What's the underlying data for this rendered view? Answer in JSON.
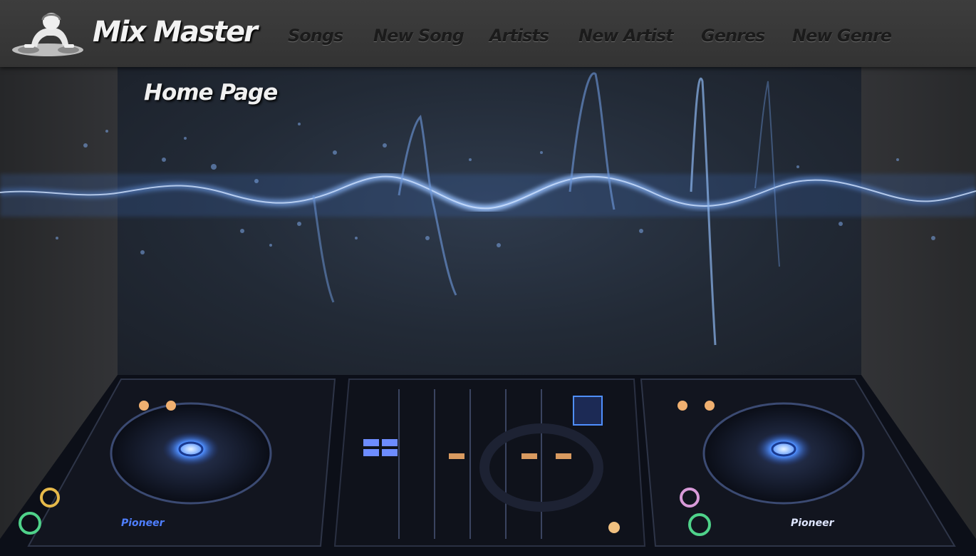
{
  "header": {
    "brand": "Mix Master",
    "nav": [
      {
        "label": "Songs"
      },
      {
        "label": "New Song"
      },
      {
        "label": "Artists"
      },
      {
        "label": "New Artist"
      },
      {
        "label": "Genres"
      },
      {
        "label": "New Genre"
      }
    ]
  },
  "main": {
    "page_title": "Home Page"
  },
  "hero": {
    "deck_brand_left": "Pioneer",
    "deck_brand_right": "Pioneer"
  },
  "icons": {
    "logo": "dj-logo-icon"
  },
  "colors": {
    "nav_bg": "#3a3a3a",
    "nav_text": "#1b1b1b",
    "brand_text": "#f2f2f2",
    "accent_blue": "#4f8fff"
  }
}
